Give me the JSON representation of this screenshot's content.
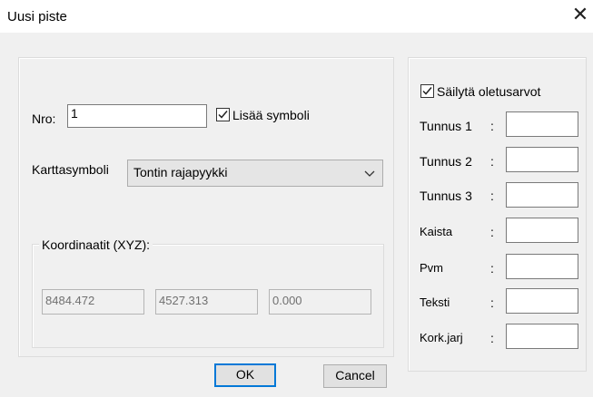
{
  "window": {
    "title": "Uusi piste",
    "close_glyph": "✕"
  },
  "left": {
    "nro_label": "Nro:",
    "nro_value": "1",
    "add_symbol_label": "Lisää symboli",
    "add_symbol_checked": true,
    "map_symbol_label": "Karttasymboli",
    "map_symbol_value": "Tontin rajapyykki",
    "coords_group_label": "Koordinaatit (XYZ):",
    "x": "8484.472",
    "y": "4527.313",
    "z": "0.000"
  },
  "right": {
    "keep_defaults_label": "Säilytä oletusarvot",
    "keep_defaults_checked": true,
    "fields": [
      {
        "label": "Tunnus 1",
        "colon": ":",
        "value": ""
      },
      {
        "label": "Tunnus 2",
        "colon": ":",
        "value": ""
      },
      {
        "label": "Tunnus 3",
        "colon": ":",
        "value": ""
      },
      {
        "label": "Kaista",
        "colon": ":",
        "value": ""
      },
      {
        "label": "Pvm",
        "colon": ":",
        "value": ""
      },
      {
        "label": "Teksti",
        "colon": ":",
        "value": ""
      },
      {
        "label": "Kork.jarj",
        "colon": ":",
        "value": ""
      }
    ]
  },
  "buttons": {
    "ok": "OK",
    "cancel": "Cancel"
  }
}
